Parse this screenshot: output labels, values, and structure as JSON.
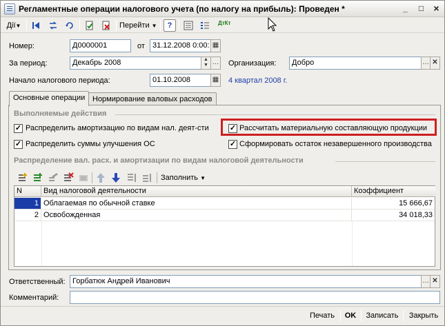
{
  "window": {
    "title": "Регламентные операции налогового учета (по налогу на прибыль): Проведен *",
    "minimize": "_",
    "maximize": "□",
    "close": "×"
  },
  "toolbar": {
    "actions_label": "Дії",
    "goto_label": "Перейти",
    "help_label": "?",
    "dtkt_label": "ДтКт"
  },
  "form": {
    "number_label": "Номер:",
    "number_value": "Д0000001",
    "date_from_label": "от",
    "date_value": "31.12.2008 0:00:",
    "period_label": "За период:",
    "period_value": "Декабрь 2008",
    "org_label": "Организация:",
    "org_value": "Добро",
    "tax_start_label": "Начало налогового периода:",
    "tax_start_value": "01.10.2008",
    "quarter_text": "4 квартал 2008 г."
  },
  "tabs": [
    {
      "label": "Основные операции"
    },
    {
      "label": "Нормирование валовых расходов"
    }
  ],
  "operations": {
    "section_title": "Выполняемые действия",
    "items": [
      {
        "label": "Распределить амортизацию по видам нал. деят-сти",
        "checked": true
      },
      {
        "label": "Рассчитать материальную составляющую продукции",
        "checked": true
      },
      {
        "label": "Распределить суммы улучшения ОС",
        "checked": true
      },
      {
        "label": "Сформировать остаток незавершенного производства",
        "checked": true
      }
    ]
  },
  "distribution": {
    "section_title": "Распределение вал. расх. и амортизации по видам налоговой деятельности",
    "fill_label": "Заполнить",
    "columns": [
      "N",
      "Вид налоговой деятельности",
      "Коэффициент"
    ],
    "rows": [
      {
        "n": "1",
        "kind": "Облагаемая по обычной ставке",
        "coef": "15 666,67"
      },
      {
        "n": "2",
        "kind": "Освобожденная",
        "coef": "34 018,33"
      }
    ]
  },
  "footer": {
    "responsible_label": "Ответственный:",
    "responsible_value": "Горбатюк Андрей Иванович",
    "comment_label": "Комментарий:",
    "comment_value": "",
    "print_label": "Печать",
    "ok_label": "OK",
    "save_label": "Записать",
    "close_label": "Закрыть"
  },
  "colors": {
    "highlight": "#cc1f1f",
    "selected_row": "#1a3ca8",
    "link_text": "#1e3ea8"
  }
}
